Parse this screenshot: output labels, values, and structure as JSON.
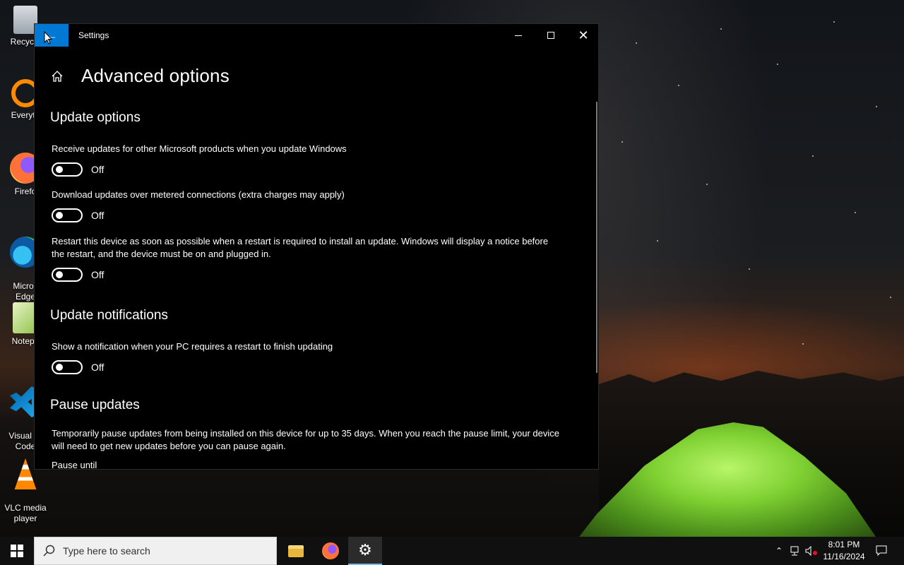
{
  "desktop": {
    "icons": [
      {
        "label": "Recycle"
      },
      {
        "label": "Everyth"
      },
      {
        "label": "Firefo"
      },
      {
        "label": "Micros\nEdge"
      },
      {
        "label": "Notepa"
      },
      {
        "label": "Visual St\nCode"
      },
      {
        "label": "VLC media\nplayer"
      }
    ]
  },
  "window": {
    "title": "Settings",
    "page_title": "Advanced options",
    "sections": {
      "update_options": {
        "title": "Update options",
        "settings": [
          {
            "label": "Receive updates for other Microsoft products when you update Windows",
            "state": "Off"
          },
          {
            "label": "Download updates over metered connections (extra charges may apply)",
            "state": "Off"
          },
          {
            "label": "Restart this device as soon as possible when a restart is required to install an update. Windows will display a notice before the restart, and the device must be on and plugged in.",
            "state": "Off"
          }
        ]
      },
      "update_notifications": {
        "title": "Update notifications",
        "settings": [
          {
            "label": "Show a notification when your PC requires a restart to finish updating",
            "state": "Off"
          }
        ]
      },
      "pause_updates": {
        "title": "Pause updates",
        "description": "Temporarily pause updates from being installed on this device for up to 35 days. When you reach the pause limit, your device will need to get new updates before you can pause again.",
        "pause_until_label": "Pause until"
      }
    }
  },
  "taskbar": {
    "search_placeholder": "Type here to search",
    "time": "8:01 PM",
    "date": "11/16/2024"
  },
  "colors": {
    "accent": "#0078d4",
    "window_bg": "#000000",
    "taskbar_bg": "#101010"
  }
}
